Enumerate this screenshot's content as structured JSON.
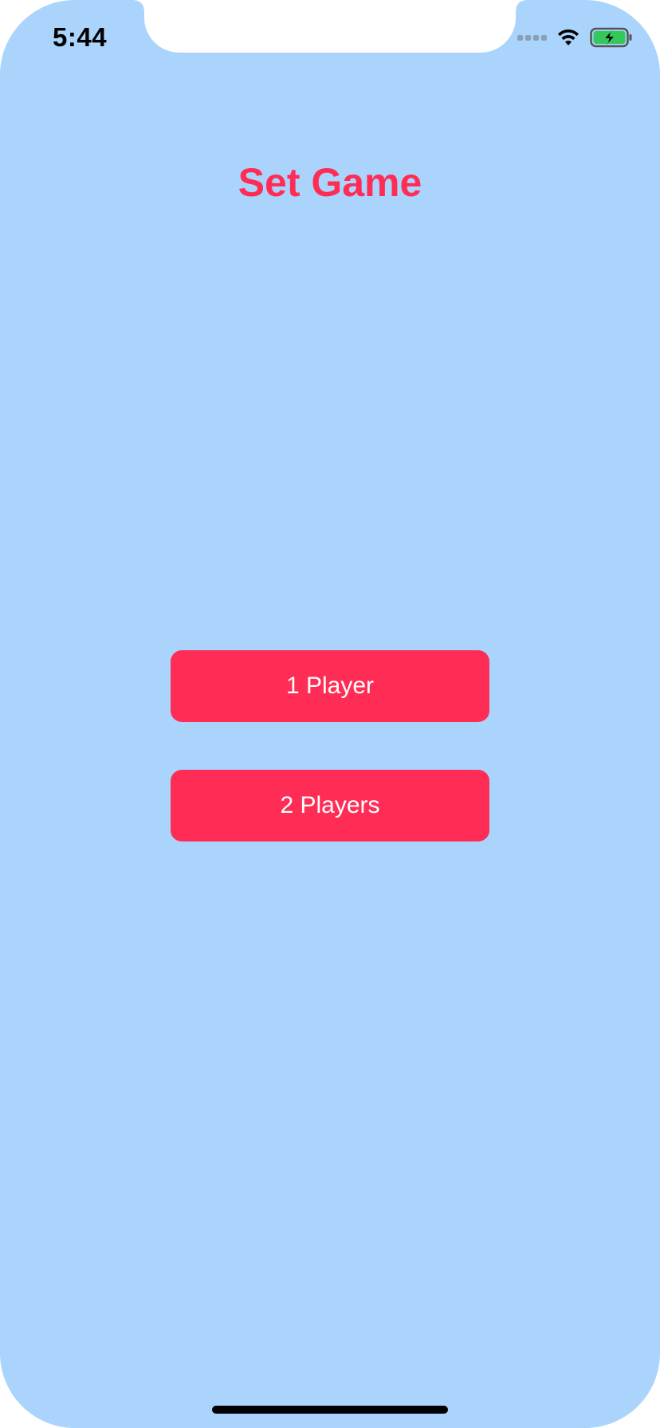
{
  "status_bar": {
    "time": "5:44",
    "icons": [
      "cellular-signal-icon",
      "wifi-icon",
      "battery-charging-icon"
    ]
  },
  "main": {
    "title": "Set Game",
    "buttons": [
      {
        "label": "1 Player"
      },
      {
        "label": "2 Players"
      }
    ]
  },
  "colors": {
    "background": "#aad4fc",
    "accent": "#ff2d55",
    "button_text": "#ffffff",
    "battery_fill": "#34c759"
  }
}
